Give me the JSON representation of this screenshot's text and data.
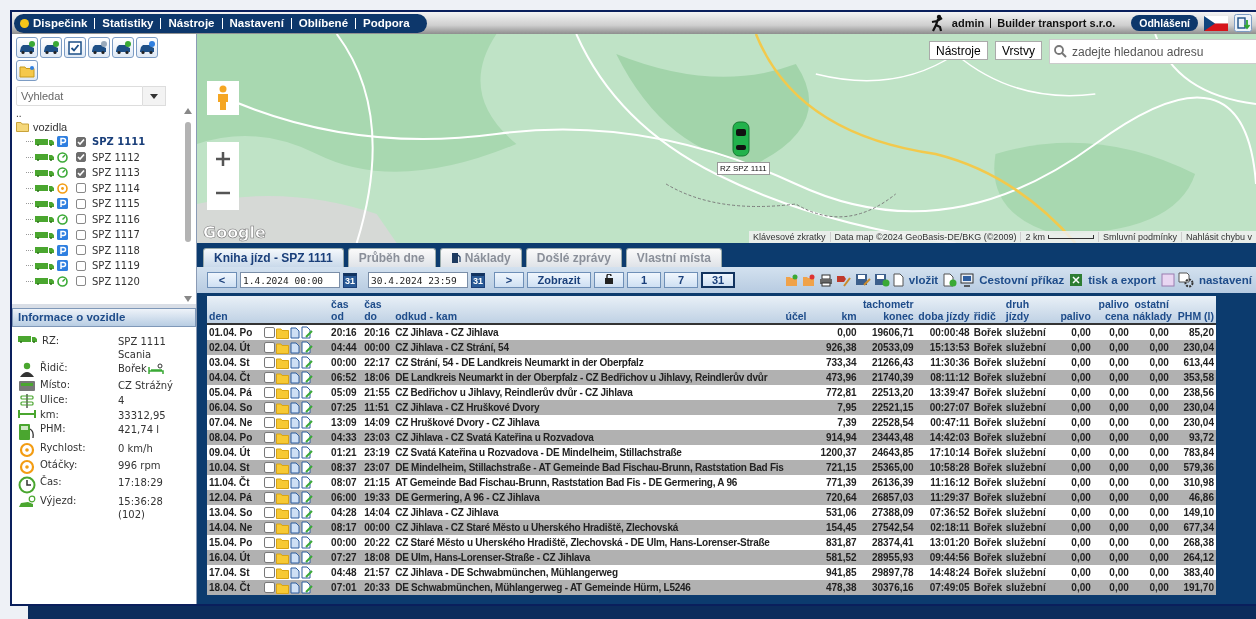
{
  "top_bar": {
    "menu": [
      "Dispečink",
      "Statistiky",
      "Nástroje",
      "Nastavení",
      "Oblíbené",
      "Podpora"
    ],
    "user": "admin",
    "company": "Builder transport s.r.o.",
    "logout": "Odhlášení"
  },
  "sidebar": {
    "search": {
      "placeholder": "Vyhledat"
    },
    "tree": {
      "up": "..",
      "label": "vozidla",
      "children": [
        {
          "label": "SPZ 1111",
          "kind": "parked",
          "checked": true,
          "selected": true
        },
        {
          "label": "SPZ 1112",
          "kind": "driving",
          "checked": true,
          "selected": false
        },
        {
          "label": "SPZ 1113",
          "kind": "driving",
          "checked": true,
          "selected": false
        },
        {
          "label": "SPZ 1114",
          "kind": "idle",
          "checked": false,
          "selected": false
        },
        {
          "label": "SPZ 1115",
          "kind": "parked",
          "checked": false,
          "selected": false
        },
        {
          "label": "SPZ 1116",
          "kind": "driving",
          "checked": false,
          "selected": false
        },
        {
          "label": "SPZ 1117",
          "kind": "parked",
          "checked": false,
          "selected": false
        },
        {
          "label": "SPZ 1118",
          "kind": "parked",
          "checked": false,
          "selected": false
        },
        {
          "label": "SPZ 1119",
          "kind": "parked",
          "checked": false,
          "selected": false
        },
        {
          "label": "SPZ 1120",
          "kind": "driving",
          "checked": false,
          "selected": false
        }
      ]
    }
  },
  "vehicle_info": {
    "title": "Informace o vozidle",
    "rows": [
      {
        "kind": "truck",
        "label": "RZ:",
        "value": [
          "SPZ 1111",
          "Scania"
        ]
      },
      {
        "kind": "driver",
        "label": "Řidič:",
        "value": [
          "Bořek"
        ]
      },
      {
        "kind": "place",
        "label": "Místo:",
        "value": [
          "CZ Strážný"
        ]
      },
      {
        "kind": "street",
        "label": "Ulice:",
        "value": [
          "4"
        ]
      },
      {
        "kind": "distance",
        "label": "km:",
        "value": [
          "33312,95"
        ]
      },
      {
        "kind": "fuel",
        "label": "PHM:",
        "value": [
          "421,74 l"
        ]
      },
      {
        "kind": "gauge",
        "label": "Rychlost:",
        "value": [
          "0 km/h"
        ]
      },
      {
        "kind": "gauge",
        "label": "Otáčky:",
        "value": [
          "996 rpm"
        ]
      },
      {
        "kind": "clock",
        "label": "Čas:",
        "value": [
          "17:18:29"
        ]
      },
      {
        "kind": "departure",
        "label": "Výjezd:",
        "value": [
          "15:36:28",
          "(102)"
        ]
      }
    ]
  },
  "map": {
    "buttons": [
      "Nástroje",
      "Vrstvy"
    ],
    "search": {
      "placeholder": "zadejte hledanou adresu"
    },
    "logo": "Google",
    "marker": {
      "label": "RZ SPZ 1111"
    },
    "attribution": [
      "Klávesové zkratky",
      "Data map ©2024 GeoBasis-DE/BKG (©2009)"
    ],
    "scale": "2 km",
    "links": [
      "Smluvní podmínky",
      "Nahlásit chybu v"
    ]
  },
  "tabs": [
    {
      "label": "Kniha jízd - SPZ 1111",
      "selected": true,
      "has_icon": false
    },
    {
      "label": "Průběh dne",
      "selected": false,
      "has_icon": false
    },
    {
      "label": "Náklady",
      "selected": false,
      "has_icon": true
    },
    {
      "label": "Došlé zprávy",
      "selected": false,
      "has_icon": false
    },
    {
      "label": "Vlastní místa",
      "selected": false,
      "has_icon": false
    }
  ],
  "toolbar": {
    "prev": "<",
    "from": "1.4.2024 00:00",
    "from_calendar": "31",
    "to": "30.4.2024 23:59",
    "to_calendar": "31",
    "next": ">",
    "show": "Zobrazit",
    "ranges": [
      {
        "label": "1",
        "selected": false
      },
      {
        "label": "7",
        "selected": false
      },
      {
        "label": "31",
        "selected": true
      }
    ],
    "insert": "vložit",
    "travel_order": "Cestovní příkaz",
    "print_export": "tisk a export",
    "settings": "nastavení"
  },
  "table": {
    "columns": [
      "den",
      "čas od",
      "čas do",
      "odkud - kam",
      "účel",
      "km",
      "tachometr konec",
      "doba jízdy",
      "řidič",
      "druh jízdy",
      "palivo",
      "palivo cena",
      "ostatní náklady",
      "PHM (l)"
    ],
    "rows": [
      {
        "day": "01.04. Po",
        "checked": false,
        "from": "20:16",
        "to": "20:16",
        "route": "CZ Jihlava - CZ Jihlava",
        "km": "0,00",
        "odometer": "19606,71",
        "duration": "00:00:48",
        "driver": "Bořek",
        "type": "služební",
        "fuel": "0,00",
        "fuel_price": "0,00",
        "other": "0,00",
        "phm": "85,20"
      },
      {
        "day": "02.04. Út",
        "checked": false,
        "from": "04:44",
        "to": "00:00",
        "route": "CZ Jihlava - CZ Strání, 54",
        "km": "926,38",
        "odometer": "20533,09",
        "duration": "15:13:53",
        "driver": "Bořek",
        "type": "služební",
        "fuel": "0,00",
        "fuel_price": "0,00",
        "other": "0,00",
        "phm": "230,04"
      },
      {
        "day": "03.04. St",
        "checked": false,
        "from": "00:00",
        "to": "22:17",
        "route": "CZ Strání, 54 - DE Landkreis Neumarkt in der Oberpfalz",
        "km": "733,34",
        "odometer": "21266,43",
        "duration": "11:30:36",
        "driver": "Bořek",
        "type": "služební",
        "fuel": "0,00",
        "fuel_price": "0,00",
        "other": "0,00",
        "phm": "613,44"
      },
      {
        "day": "04.04. Čt",
        "checked": false,
        "from": "06:52",
        "to": "18:06",
        "route": "DE Landkreis Neumarkt in der Oberpfalz - CZ Bedřichov u Jihlavy, Reindlerův dvůr",
        "km": "473,96",
        "odometer": "21740,39",
        "duration": "08:11:12",
        "driver": "Bořek",
        "type": "služební",
        "fuel": "0,00",
        "fuel_price": "0,00",
        "other": "0,00",
        "phm": "353,58"
      },
      {
        "day": "05.04. Pá",
        "checked": false,
        "from": "05:09",
        "to": "21:55",
        "route": "CZ Bedřichov u Jihlavy, Reindlerův dvůr - CZ Jihlava",
        "km": "772,81",
        "odometer": "22513,20",
        "duration": "13:39:47",
        "driver": "Bořek",
        "type": "služební",
        "fuel": "0,00",
        "fuel_price": "0,00",
        "other": "0,00",
        "phm": "238,56"
      },
      {
        "day": "06.04. So",
        "checked": false,
        "from": "07:25",
        "to": "11:51",
        "route": "CZ Jihlava - CZ Hruškové Dvory",
        "km": "7,95",
        "odometer": "22521,15",
        "duration": "00:27:07",
        "driver": "Bořek",
        "type": "služební",
        "fuel": "0,00",
        "fuel_price": "0,00",
        "other": "0,00",
        "phm": "230,04"
      },
      {
        "day": "07.04. Ne",
        "checked": false,
        "from": "13:09",
        "to": "14:09",
        "route": "CZ Hruškové Dvory - CZ Jihlava",
        "km": "7,39",
        "odometer": "22528,54",
        "duration": "00:47:11",
        "driver": "Bořek",
        "type": "služební",
        "fuel": "0,00",
        "fuel_price": "0,00",
        "other": "0,00",
        "phm": "230,04"
      },
      {
        "day": "08.04. Po",
        "checked": false,
        "from": "04:33",
        "to": "23:03",
        "route": "CZ Jihlava - CZ Svatá Kateřina u Rozvadova",
        "km": "914,94",
        "odometer": "23443,48",
        "duration": "14:42:03",
        "driver": "Bořek",
        "type": "služební",
        "fuel": "0,00",
        "fuel_price": "0,00",
        "other": "0,00",
        "phm": "93,72"
      },
      {
        "day": "09.04. Út",
        "checked": false,
        "from": "01:21",
        "to": "23:19",
        "route": "CZ Svatá Kateřina u Rozvadova - DE Mindelheim, Stillachstraße",
        "km": "1200,37",
        "odometer": "24643,85",
        "duration": "17:10:14",
        "driver": "Bořek",
        "type": "služební",
        "fuel": "0,00",
        "fuel_price": "0,00",
        "other": "0,00",
        "phm": "783,84"
      },
      {
        "day": "10.04. St",
        "checked": false,
        "from": "08:37",
        "to": "23:07",
        "route": "DE Mindelheim, Stillachstraße - AT Gemeinde Bad Fischau-Brunn, Raststation Bad Fis",
        "km": "721,15",
        "odometer": "25365,00",
        "duration": "10:58:28",
        "driver": "Bořek",
        "type": "služební",
        "fuel": "0,00",
        "fuel_price": "0,00",
        "other": "0,00",
        "phm": "579,36"
      },
      {
        "day": "11.04. Čt",
        "checked": false,
        "from": "08:07",
        "to": "21:15",
        "route": "AT Gemeinde Bad Fischau-Brunn, Raststation Bad Fis - DE Germering, A 96",
        "km": "771,39",
        "odometer": "26136,39",
        "duration": "11:16:12",
        "driver": "Bořek",
        "type": "služební",
        "fuel": "0,00",
        "fuel_price": "0,00",
        "other": "0,00",
        "phm": "310,98"
      },
      {
        "day": "12.04. Pá",
        "checked": false,
        "from": "06:00",
        "to": "19:33",
        "route": "DE Germering, A 96 - CZ Jihlava",
        "km": "720,64",
        "odometer": "26857,03",
        "duration": "11:29:37",
        "driver": "Bořek",
        "type": "služební",
        "fuel": "0,00",
        "fuel_price": "0,00",
        "other": "0,00",
        "phm": "46,86"
      },
      {
        "day": "13.04. So",
        "checked": false,
        "from": "04:28",
        "to": "14:04",
        "route": "CZ Jihlava - CZ Jihlava",
        "km": "531,06",
        "odometer": "27388,09",
        "duration": "07:36:52",
        "driver": "Bořek",
        "type": "služební",
        "fuel": "0,00",
        "fuel_price": "0,00",
        "other": "0,00",
        "phm": "149,10"
      },
      {
        "day": "14.04. Ne",
        "checked": false,
        "from": "08:17",
        "to": "00:00",
        "route": "CZ Jihlava - CZ Staré Město u Uherského Hradiště, Zlechovská",
        "km": "154,45",
        "odometer": "27542,54",
        "duration": "02:18:11",
        "driver": "Bořek",
        "type": "služební",
        "fuel": "0,00",
        "fuel_price": "0,00",
        "other": "0,00",
        "phm": "677,34"
      },
      {
        "day": "15.04. Po",
        "checked": false,
        "from": "00:00",
        "to": "20:22",
        "route": "CZ Staré Město u Uherského Hradiště, Zlechovská - DE Ulm, Hans-Lorenser-Straße",
        "km": "831,87",
        "odometer": "28374,41",
        "duration": "13:01:20",
        "driver": "Bořek",
        "type": "služební",
        "fuel": "0,00",
        "fuel_price": "0,00",
        "other": "0,00",
        "phm": "268,38"
      },
      {
        "day": "16.04. Út",
        "checked": false,
        "from": "07:27",
        "to": "18:08",
        "route": "DE Ulm, Hans-Lorenser-Straße - CZ Jihlava",
        "km": "581,52",
        "odometer": "28955,93",
        "duration": "09:44:56",
        "driver": "Bořek",
        "type": "služební",
        "fuel": "0,00",
        "fuel_price": "0,00",
        "other": "0,00",
        "phm": "264,12"
      },
      {
        "day": "17.04. St",
        "checked": false,
        "from": "04:48",
        "to": "21:57",
        "route": "CZ Jihlava - DE Schwabmünchen, Mühlangerweg",
        "km": "941,85",
        "odometer": "29897,78",
        "duration": "14:48:24",
        "driver": "Bořek",
        "type": "služební",
        "fuel": "0,00",
        "fuel_price": "0,00",
        "other": "0,00",
        "phm": "383,40"
      },
      {
        "day": "18.04. Čt",
        "checked": false,
        "from": "07:01",
        "to": "20:33",
        "route": "DE Schwabmünchen, Mühlangerweg - AT Gemeinde Hürm, L5246",
        "km": "478,38",
        "odometer": "30376,16",
        "duration": "07:49:05",
        "driver": "Bořek",
        "type": "služební",
        "fuel": "0,00",
        "fuel_price": "0,00",
        "other": "0,00",
        "phm": "191,70"
      }
    ]
  }
}
